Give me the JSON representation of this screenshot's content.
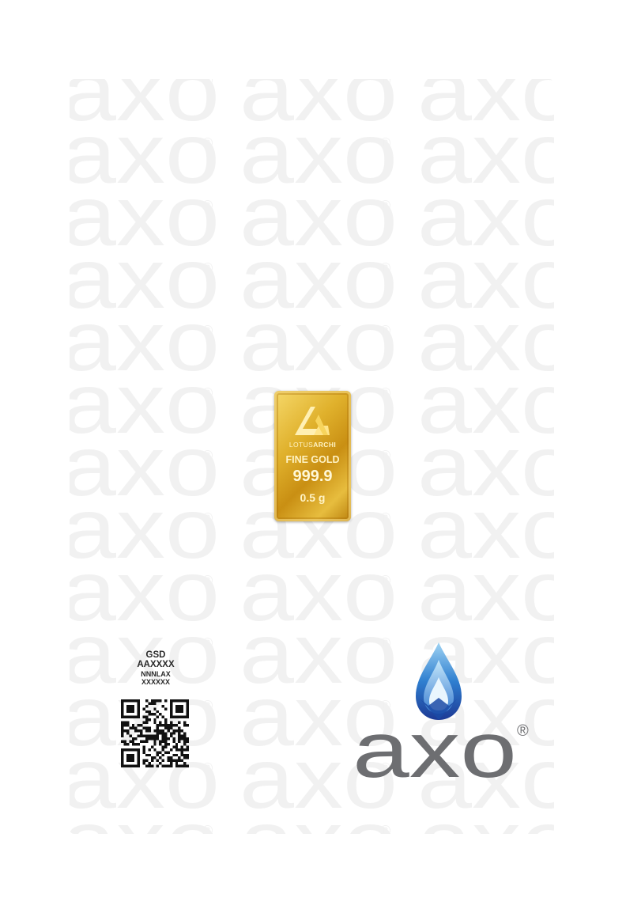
{
  "background": {
    "watermark_text": "axo",
    "registered_mark": "®",
    "watermark_color": "#f1f1f1"
  },
  "gold_bar": {
    "brand_plain": "LOTUS",
    "brand_bold": "ARCHI",
    "fine_gold": "FINE GOLD",
    "purity": "999.9",
    "weight": "0.5 g",
    "color": "#d9a521"
  },
  "serials": {
    "line1": "GSD",
    "line2": "AAXXXX",
    "line3": "NNNLAX",
    "line4": "XXXXXX"
  },
  "qr_code": {
    "icon": "qr-code-icon"
  },
  "brand_logo": {
    "text": "axo",
    "registered": "®",
    "text_color": "#6d6e71",
    "drop_colors": [
      "#1e3f9a",
      "#3a8fd8",
      "#a9d8f5"
    ]
  }
}
